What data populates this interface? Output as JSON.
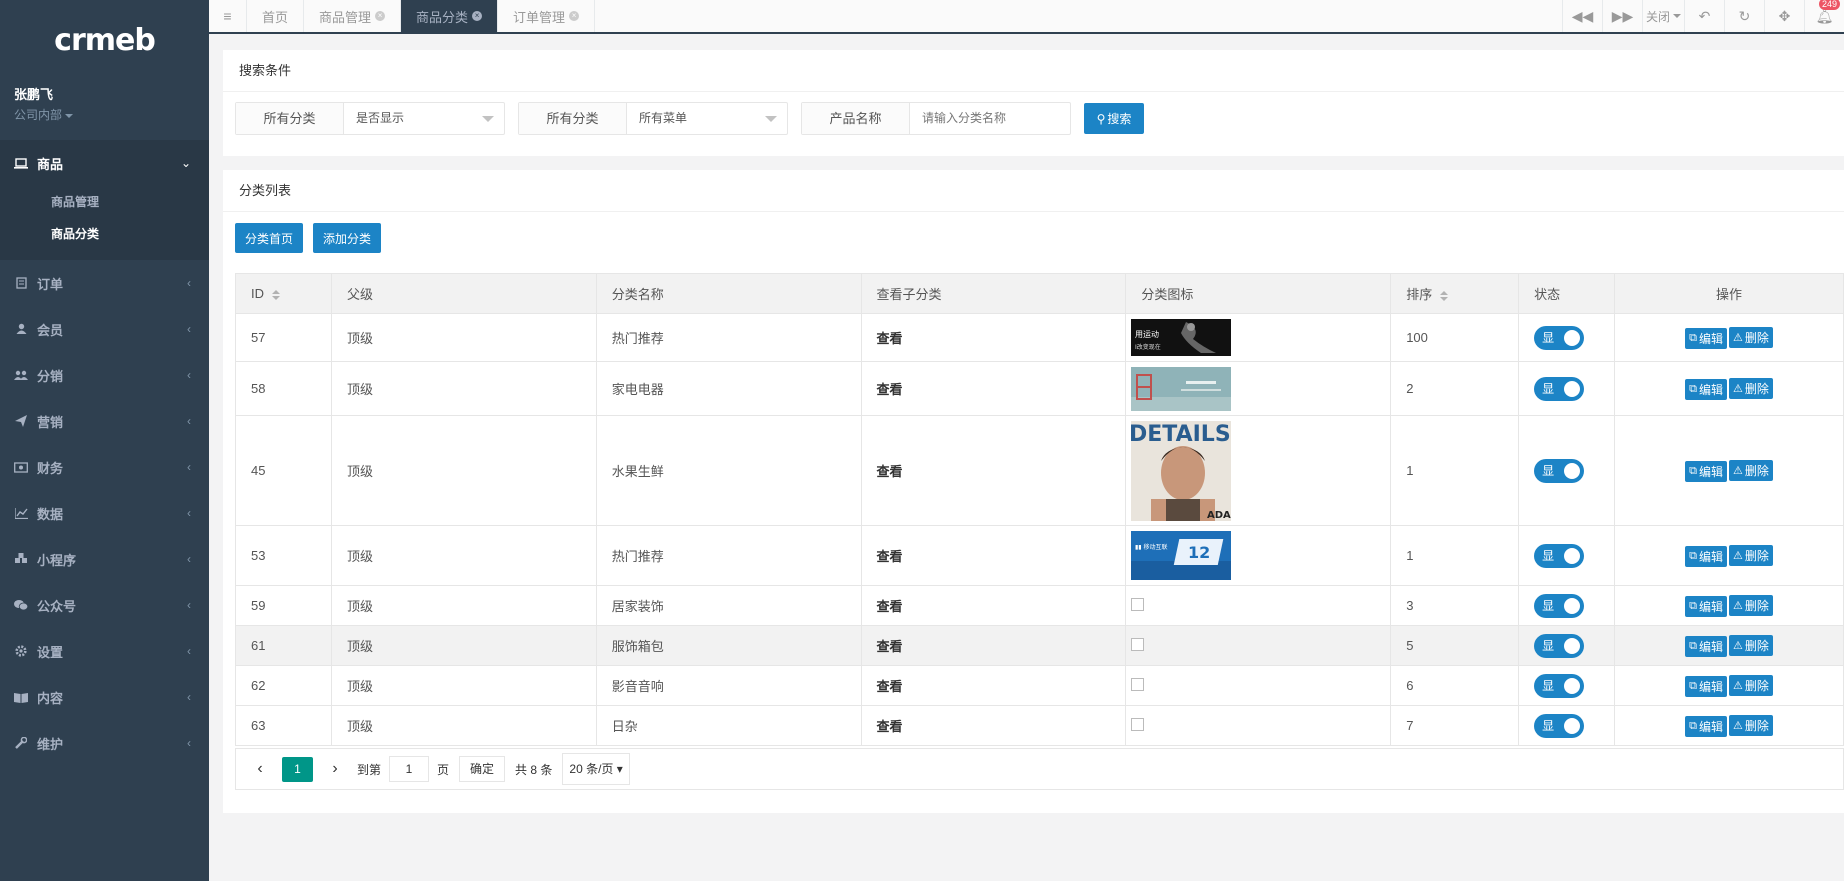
{
  "sidebar": {
    "logo": "crmeb",
    "user_name": "张鹏飞",
    "user_dept": "公司内部",
    "product_menu": "商品",
    "sub_items": [
      "商品管理",
      "商品分类"
    ],
    "menu": [
      {
        "label": "订单",
        "icon": "order-icon"
      },
      {
        "label": "会员",
        "icon": "user-icon"
      },
      {
        "label": "分销",
        "icon": "group-icon"
      },
      {
        "label": "营销",
        "icon": "send-icon"
      },
      {
        "label": "财务",
        "icon": "money-icon"
      },
      {
        "label": "数据",
        "icon": "chart-icon"
      },
      {
        "label": "小程序",
        "icon": "cube-icon"
      },
      {
        "label": "公众号",
        "icon": "wechat-icon"
      },
      {
        "label": "设置",
        "icon": "gear-icon"
      },
      {
        "label": "内容",
        "icon": "book-icon"
      },
      {
        "label": "维护",
        "icon": "wrench-icon"
      }
    ]
  },
  "topbar": {
    "tabs": [
      "首页",
      "商品管理",
      "商品分类",
      "订单管理"
    ],
    "close_label": "关闭",
    "badge": "249"
  },
  "search": {
    "title": "搜索条件",
    "group1_label": "所有分类",
    "group1_value": "是否显示",
    "group2_label": "所有分类",
    "group2_value": "所有菜单",
    "group3_label": "产品名称",
    "group3_placeholder": "请输入分类名称",
    "button": "搜索"
  },
  "list": {
    "title": "分类列表",
    "btn_home": "分类首页",
    "btn_add": "添加分类",
    "headers": {
      "id": "ID",
      "parent": "父级",
      "name": "分类名称",
      "view_sub": "查看子分类",
      "icon": "分类图标",
      "sort": "排序",
      "status": "状态",
      "ops": "操作"
    },
    "rows": [
      {
        "id": "57",
        "parent": "顶级",
        "name": "热门推荐",
        "view": "查看",
        "sort": "100",
        "status": "显"
      },
      {
        "id": "58",
        "parent": "顶级",
        "name": "家电电器",
        "view": "查看",
        "sort": "2",
        "status": "显"
      },
      {
        "id": "45",
        "parent": "顶级",
        "name": "水果生鲜",
        "view": "查看",
        "sort": "1",
        "status": "显"
      },
      {
        "id": "53",
        "parent": "顶级",
        "name": "热门推荐",
        "view": "查看",
        "sort": "1",
        "status": "显"
      },
      {
        "id": "59",
        "parent": "顶级",
        "name": "居家装饰",
        "view": "查看",
        "sort": "3",
        "status": "显"
      },
      {
        "id": "61",
        "parent": "顶级",
        "name": "服饰箱包",
        "view": "查看",
        "sort": "5",
        "status": "显"
      },
      {
        "id": "62",
        "parent": "顶级",
        "name": "影音音响",
        "view": "查看",
        "sort": "6",
        "status": "显"
      },
      {
        "id": "63",
        "parent": "顶级",
        "name": "日杂",
        "view": "查看",
        "sort": "7",
        "status": "显"
      }
    ],
    "edit": "编辑",
    "delete": "删除",
    "image_texts": {
      "img1": "用运动 I改变现在",
      "img3": "DETAILS ADAM"
    }
  },
  "pager": {
    "current": "1",
    "goto_label": "到第",
    "page_value": "1",
    "page_unit": "页",
    "confirm": "确定",
    "total": "共 8 条",
    "page_size": "20 条/页"
  },
  "colors": {
    "sidebar_bg": "#2f4050",
    "accent_blue": "#1c84c6",
    "pager_green": "#009688"
  }
}
